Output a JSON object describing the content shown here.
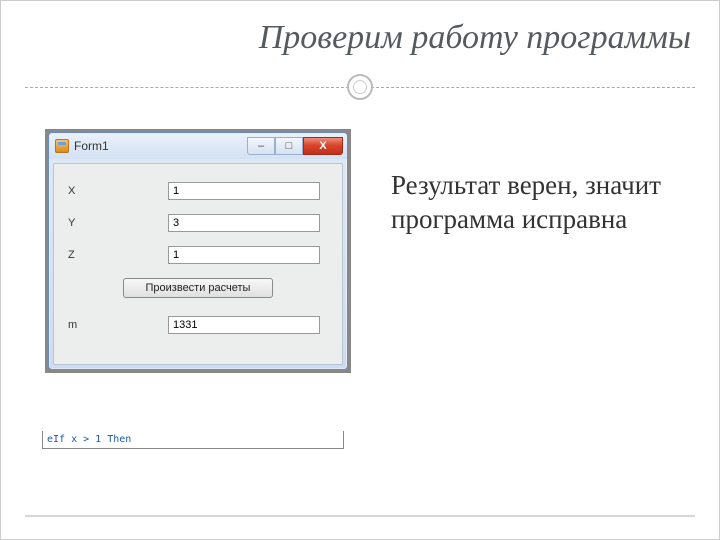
{
  "slide": {
    "title": "Проверим работу программы",
    "note": "Результат верен, значит программа исправна"
  },
  "window": {
    "title": "Form1",
    "buttons": {
      "minimize": "–",
      "maximize": "□",
      "close": "X"
    },
    "fields": {
      "x": {
        "label": "X",
        "value": "1"
      },
      "y": {
        "label": "Y",
        "value": "3"
      },
      "z": {
        "label": "Z",
        "value": "1"
      },
      "m": {
        "label": "m",
        "value": "1331"
      }
    },
    "calc_button": "Произвести расчеты",
    "code_peek": "eIf x > 1 Then"
  }
}
